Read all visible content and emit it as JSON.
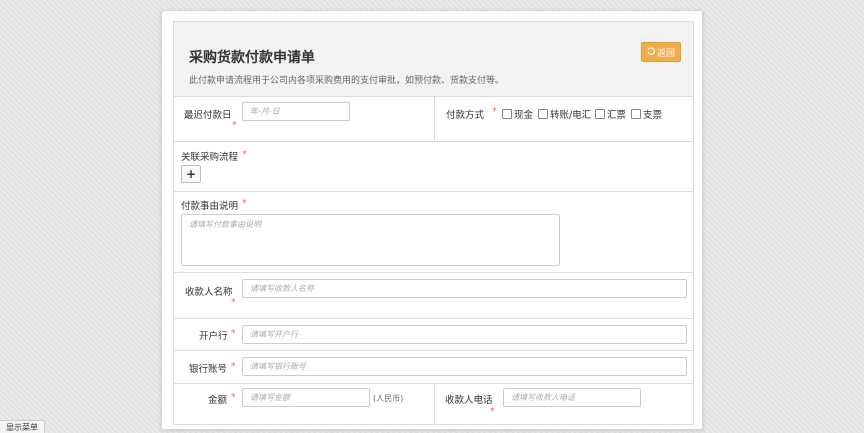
{
  "header": {
    "title": "采购货款付款申请单",
    "description": "此付款申请流程用于公司内各项采购费用的支付审批，如预付款、货款支付等。",
    "back_label": "返回"
  },
  "required_mark": "*",
  "fields": {
    "latest_pay_date": {
      "label": "最迟付款日",
      "placeholder": "年-月-日"
    },
    "pay_method": {
      "label": "付款方式",
      "options": [
        "现金",
        "转账/电汇",
        "汇票",
        "支票"
      ]
    },
    "related_process": {
      "label": "关联采购流程",
      "add_label": "+"
    },
    "reason": {
      "label": "付款事由说明",
      "placeholder": "请填写付款事由说明"
    },
    "payee_name": {
      "label": "收款人名称",
      "placeholder": "请填写收款人名称"
    },
    "bank": {
      "label": "开户行",
      "placeholder": "请填写开户行"
    },
    "account": {
      "label": "银行账号",
      "placeholder": "请填写银行账号"
    },
    "amount": {
      "label": "金额",
      "placeholder": "请填写金额",
      "unit": "(人民币)"
    },
    "payee_phone": {
      "label": "收款人电话",
      "placeholder": "请填写收款人电话"
    }
  },
  "menu_toggle_label": "显示菜单",
  "colors": {
    "accent": "#f0ad4e",
    "required": "#e8734a"
  }
}
